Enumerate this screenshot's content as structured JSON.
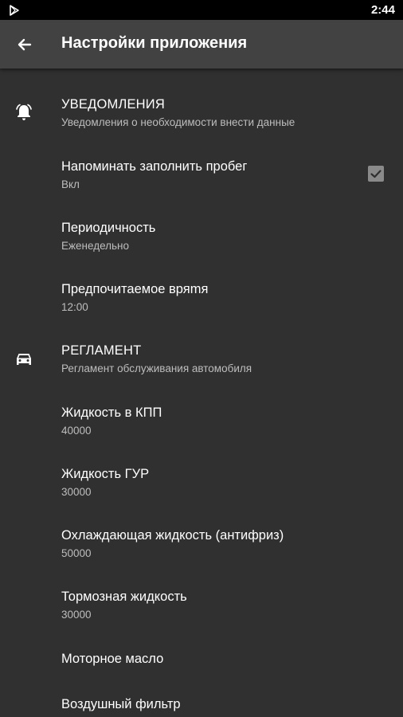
{
  "status_bar": {
    "time": "2:44",
    "play_icon": "play-store-icon"
  },
  "app_bar": {
    "back_icon": "arrow-back-icon",
    "title": "Настройки приложения"
  },
  "sections": {
    "notifications": {
      "icon": "bell-icon",
      "title": "УВЕДОМЛЕНИЯ",
      "summary": "Уведомления о необходимости внести данные"
    },
    "reminder": {
      "title": "Напоминать заполнить пробег",
      "summary": "Вкл",
      "checked": true
    },
    "period": {
      "title": "Периодичность",
      "summary": "Еженедельно"
    },
    "preferred_time": {
      "title": "Предпочитаемое вряmя",
      "summary": "12:00"
    },
    "schedule": {
      "icon": "car-icon",
      "title": "РЕГЛАМЕНТ",
      "summary": "Регламент обслуживания автомобиля"
    },
    "items": [
      {
        "title": "Жидкость в КПП",
        "summary": "40000"
      },
      {
        "title": "Жидкость ГУР",
        "summary": "30000"
      },
      {
        "title": "Охлаждающая жидкость (антифриз)",
        "summary": "50000"
      },
      {
        "title": "Тормозная жидкость",
        "summary": "30000"
      },
      {
        "title": "Моторное масло",
        "summary": ""
      },
      {
        "title": "Воздушный фильтр",
        "summary": ""
      }
    ]
  },
  "colors": {
    "background": "#303030",
    "app_bar": "#424242",
    "status_bar": "#000000",
    "checkbox": "#8a8a8a"
  }
}
